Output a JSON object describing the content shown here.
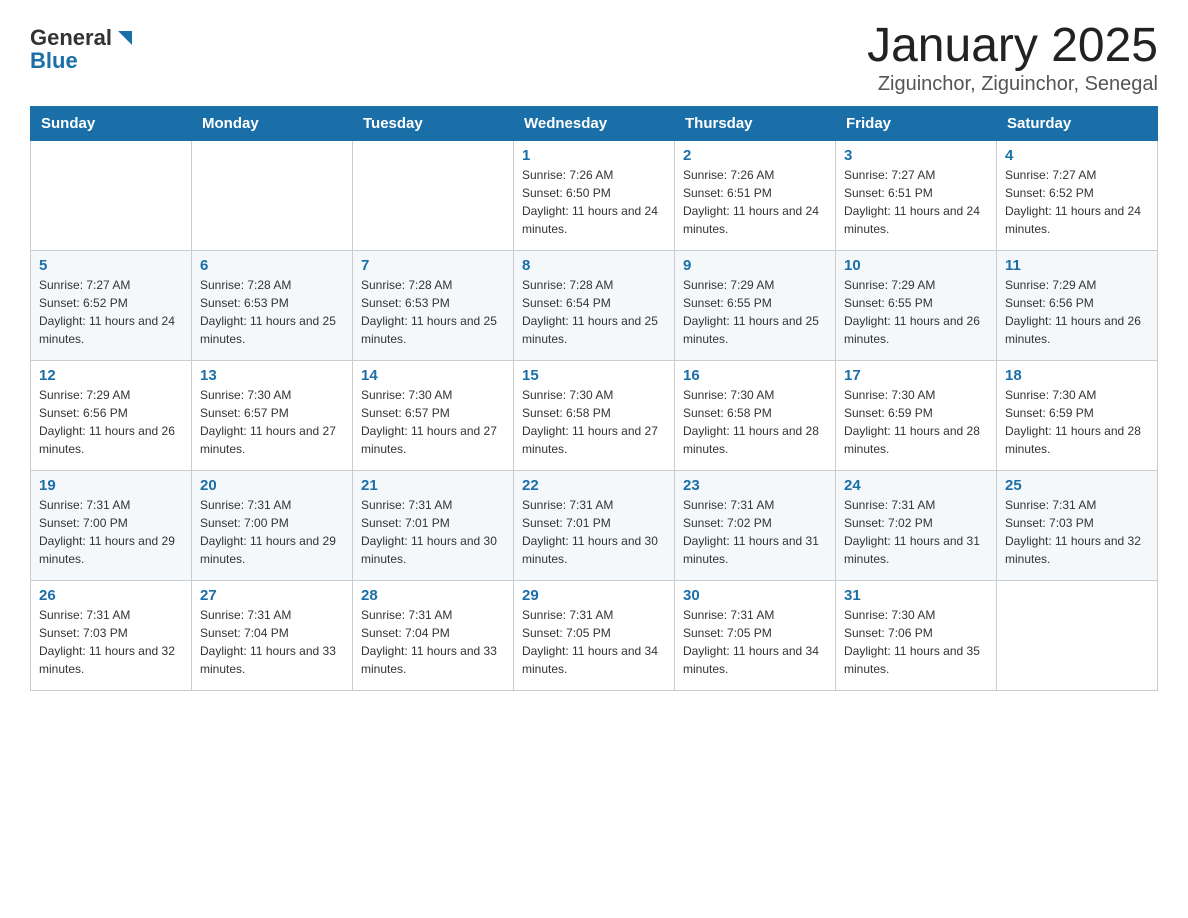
{
  "logo": {
    "general": "General",
    "blue": "Blue",
    "triangle": "▲"
  },
  "title": "January 2025",
  "subtitle": "Ziguinchor, Ziguinchor, Senegal",
  "weekdays": [
    "Sunday",
    "Monday",
    "Tuesday",
    "Wednesday",
    "Thursday",
    "Friday",
    "Saturday"
  ],
  "weeks": [
    [
      {
        "day": "",
        "info": ""
      },
      {
        "day": "",
        "info": ""
      },
      {
        "day": "",
        "info": ""
      },
      {
        "day": "1",
        "info": "Sunrise: 7:26 AM\nSunset: 6:50 PM\nDaylight: 11 hours and 24 minutes."
      },
      {
        "day": "2",
        "info": "Sunrise: 7:26 AM\nSunset: 6:51 PM\nDaylight: 11 hours and 24 minutes."
      },
      {
        "day": "3",
        "info": "Sunrise: 7:27 AM\nSunset: 6:51 PM\nDaylight: 11 hours and 24 minutes."
      },
      {
        "day": "4",
        "info": "Sunrise: 7:27 AM\nSunset: 6:52 PM\nDaylight: 11 hours and 24 minutes."
      }
    ],
    [
      {
        "day": "5",
        "info": "Sunrise: 7:27 AM\nSunset: 6:52 PM\nDaylight: 11 hours and 24 minutes."
      },
      {
        "day": "6",
        "info": "Sunrise: 7:28 AM\nSunset: 6:53 PM\nDaylight: 11 hours and 25 minutes."
      },
      {
        "day": "7",
        "info": "Sunrise: 7:28 AM\nSunset: 6:53 PM\nDaylight: 11 hours and 25 minutes."
      },
      {
        "day": "8",
        "info": "Sunrise: 7:28 AM\nSunset: 6:54 PM\nDaylight: 11 hours and 25 minutes."
      },
      {
        "day": "9",
        "info": "Sunrise: 7:29 AM\nSunset: 6:55 PM\nDaylight: 11 hours and 25 minutes."
      },
      {
        "day": "10",
        "info": "Sunrise: 7:29 AM\nSunset: 6:55 PM\nDaylight: 11 hours and 26 minutes."
      },
      {
        "day": "11",
        "info": "Sunrise: 7:29 AM\nSunset: 6:56 PM\nDaylight: 11 hours and 26 minutes."
      }
    ],
    [
      {
        "day": "12",
        "info": "Sunrise: 7:29 AM\nSunset: 6:56 PM\nDaylight: 11 hours and 26 minutes."
      },
      {
        "day": "13",
        "info": "Sunrise: 7:30 AM\nSunset: 6:57 PM\nDaylight: 11 hours and 27 minutes."
      },
      {
        "day": "14",
        "info": "Sunrise: 7:30 AM\nSunset: 6:57 PM\nDaylight: 11 hours and 27 minutes."
      },
      {
        "day": "15",
        "info": "Sunrise: 7:30 AM\nSunset: 6:58 PM\nDaylight: 11 hours and 27 minutes."
      },
      {
        "day": "16",
        "info": "Sunrise: 7:30 AM\nSunset: 6:58 PM\nDaylight: 11 hours and 28 minutes."
      },
      {
        "day": "17",
        "info": "Sunrise: 7:30 AM\nSunset: 6:59 PM\nDaylight: 11 hours and 28 minutes."
      },
      {
        "day": "18",
        "info": "Sunrise: 7:30 AM\nSunset: 6:59 PM\nDaylight: 11 hours and 28 minutes."
      }
    ],
    [
      {
        "day": "19",
        "info": "Sunrise: 7:31 AM\nSunset: 7:00 PM\nDaylight: 11 hours and 29 minutes."
      },
      {
        "day": "20",
        "info": "Sunrise: 7:31 AM\nSunset: 7:00 PM\nDaylight: 11 hours and 29 minutes."
      },
      {
        "day": "21",
        "info": "Sunrise: 7:31 AM\nSunset: 7:01 PM\nDaylight: 11 hours and 30 minutes."
      },
      {
        "day": "22",
        "info": "Sunrise: 7:31 AM\nSunset: 7:01 PM\nDaylight: 11 hours and 30 minutes."
      },
      {
        "day": "23",
        "info": "Sunrise: 7:31 AM\nSunset: 7:02 PM\nDaylight: 11 hours and 31 minutes."
      },
      {
        "day": "24",
        "info": "Sunrise: 7:31 AM\nSunset: 7:02 PM\nDaylight: 11 hours and 31 minutes."
      },
      {
        "day": "25",
        "info": "Sunrise: 7:31 AM\nSunset: 7:03 PM\nDaylight: 11 hours and 32 minutes."
      }
    ],
    [
      {
        "day": "26",
        "info": "Sunrise: 7:31 AM\nSunset: 7:03 PM\nDaylight: 11 hours and 32 minutes."
      },
      {
        "day": "27",
        "info": "Sunrise: 7:31 AM\nSunset: 7:04 PM\nDaylight: 11 hours and 33 minutes."
      },
      {
        "day": "28",
        "info": "Sunrise: 7:31 AM\nSunset: 7:04 PM\nDaylight: 11 hours and 33 minutes."
      },
      {
        "day": "29",
        "info": "Sunrise: 7:31 AM\nSunset: 7:05 PM\nDaylight: 11 hours and 34 minutes."
      },
      {
        "day": "30",
        "info": "Sunrise: 7:31 AM\nSunset: 7:05 PM\nDaylight: 11 hours and 34 minutes."
      },
      {
        "day": "31",
        "info": "Sunrise: 7:30 AM\nSunset: 7:06 PM\nDaylight: 11 hours and 35 minutes."
      },
      {
        "day": "",
        "info": ""
      }
    ]
  ]
}
